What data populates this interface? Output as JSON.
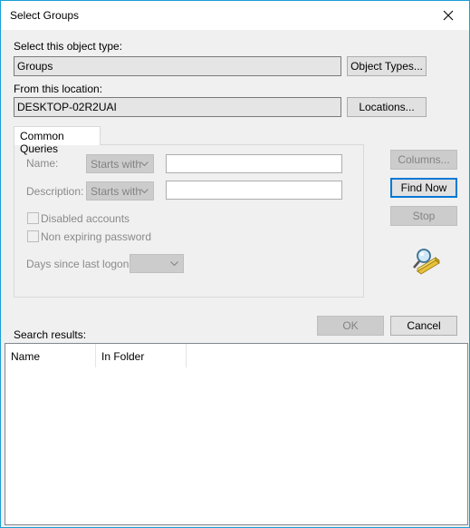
{
  "window": {
    "title": "Select Groups"
  },
  "object_type": {
    "label": "Select this object type:",
    "value": "Groups",
    "button": "Object Types..."
  },
  "location": {
    "label": "From this location:",
    "value": "DESKTOP-02R2UAI",
    "button": "Locations..."
  },
  "tabs": [
    {
      "label": "Common Queries"
    }
  ],
  "queries": {
    "name_label": "Name:",
    "name_mode": "Starts with",
    "description_label": "Description:",
    "description_mode": "Starts with",
    "disabled_accounts": "Disabled accounts",
    "non_expiring_password": "Non expiring password",
    "days_since_label": "Days since last logon:"
  },
  "side_buttons": {
    "columns": "Columns...",
    "find_now": "Find Now",
    "stop": "Stop"
  },
  "dialog_buttons": {
    "ok": "OK",
    "cancel": "Cancel"
  },
  "results": {
    "label": "Search results:",
    "columns": [
      "Name",
      "In Folder"
    ]
  },
  "colors": {
    "accent": "#0078d7",
    "frame": "#1a9fd6",
    "disabled_text": "#838383"
  },
  "icons": [
    "close-icon",
    "chevron-down-icon",
    "search-magnifier-icon"
  ]
}
